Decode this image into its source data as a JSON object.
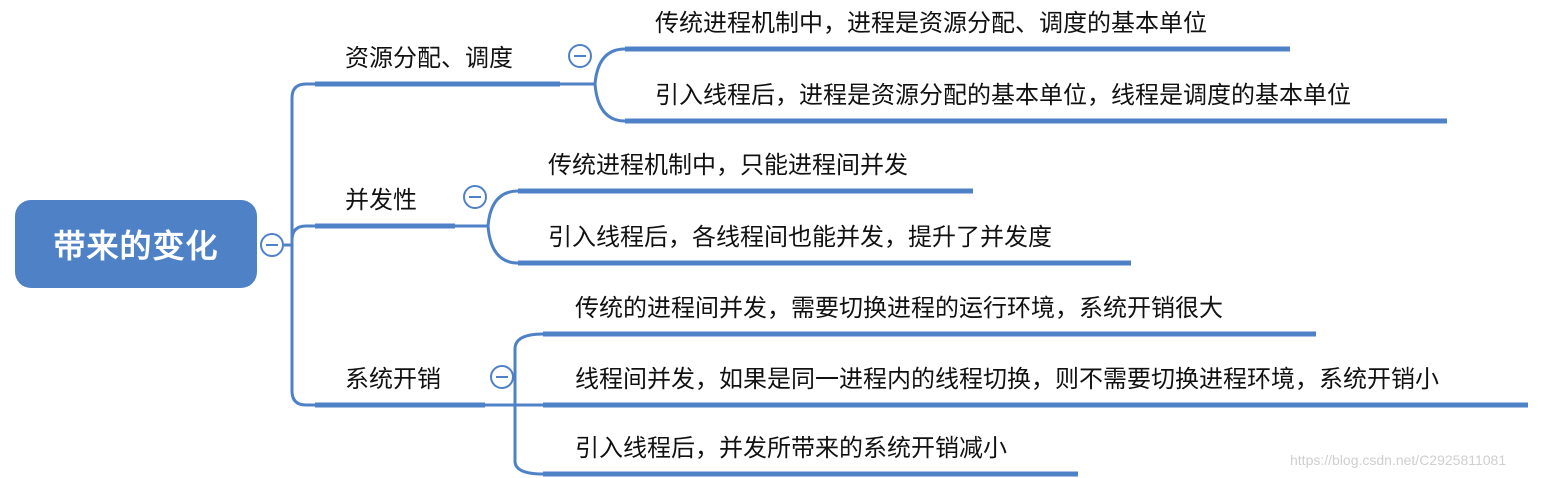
{
  "root": {
    "label": "带来的变化"
  },
  "branches": [
    {
      "label": "资源分配、调度",
      "children": [
        "传统进程机制中，进程是资源分配、调度的基本单位",
        "引入线程后，进程是资源分配的基本单位，线程是调度的基本单位"
      ]
    },
    {
      "label": "并发性",
      "children": [
        "传统进程机制中，只能进程间并发",
        "引入线程后，各线程间也能并发，提升了并发度"
      ]
    },
    {
      "label": "系统开销",
      "children": [
        "传统的进程间并发，需要切换进程的运行环境，系统开销很大",
        "线程间并发，如果是同一进程内的线程切换，则不需要切换进程环境，系统开销小",
        "引入线程后，并发所带来的系统开销减小"
      ]
    }
  ],
  "watermark": "https://blog.csdn.net/C2925811081",
  "colors": {
    "accent": "#4f81c7",
    "line": "#4f81c7"
  }
}
